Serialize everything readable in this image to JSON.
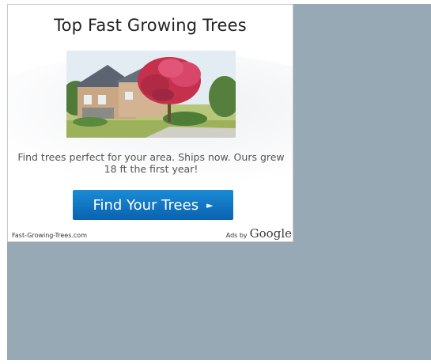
{
  "ad": {
    "title": "Top Fast Growing Trees",
    "description": "Find trees perfect for your area. Ships now. Ours grew 18 ft the first year!",
    "cta_label": "Find Your Trees",
    "cta_arrow": "►",
    "display_url": "Fast-Growing-Trees.com",
    "ads_by_label": "Ads by",
    "ads_by_brand": "Google"
  },
  "colors": {
    "page_background": "#97a9b4",
    "cta_blue": "#0f75c4",
    "ad_background": "#ffffff"
  }
}
